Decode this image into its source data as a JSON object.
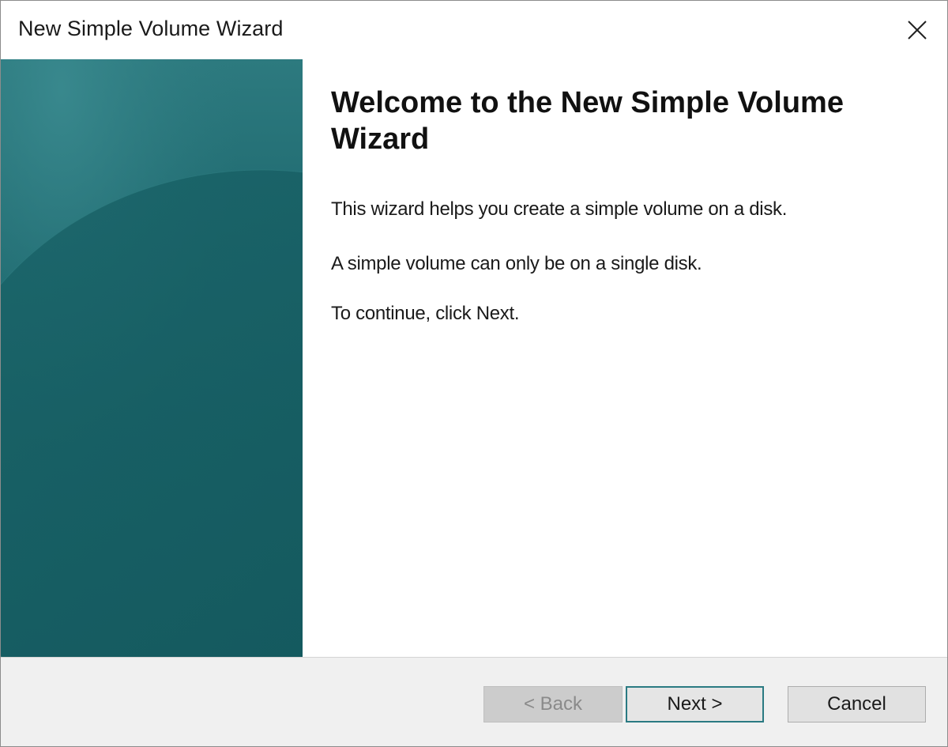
{
  "window": {
    "title": "New Simple Volume Wizard"
  },
  "icons": {
    "close": "close-icon"
  },
  "content": {
    "heading": "Welcome to the New Simple Volume Wizard",
    "paragraphs": [
      "This wizard helps you create a simple volume on a disk.",
      "A simple volume can only be on a single disk.",
      "To continue, click Next."
    ]
  },
  "buttons": {
    "back": "< Back",
    "next": "Next >",
    "cancel": "Cancel"
  },
  "colors": {
    "side_panel": "#1f6a70",
    "default_button_border": "#2a7a82"
  }
}
